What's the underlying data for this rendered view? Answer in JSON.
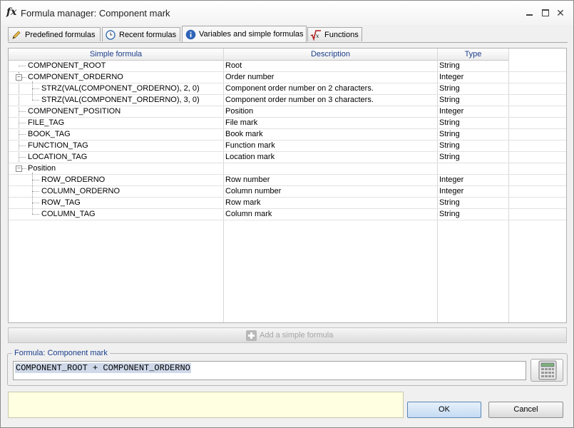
{
  "window": {
    "title": "Formula manager: Component mark",
    "icon": "fx-icon"
  },
  "tabs": [
    {
      "label": "Predefined formulas",
      "icon": "pencil-icon"
    },
    {
      "label": "Recent formulas",
      "icon": "clock-icon"
    },
    {
      "label": "Variables and simple formulas",
      "icon": "info-icon",
      "active": true
    },
    {
      "label": "Functions",
      "icon": "sqrt-x-icon"
    }
  ],
  "grid": {
    "headers": {
      "formula": "Simple formula",
      "description": "Description",
      "type": "Type"
    },
    "rows": [
      {
        "formula": "COMPONENT_ROOT",
        "description": "Root",
        "type": "String"
      },
      {
        "formula": "COMPONENT_ORDERNO",
        "description": "Order number",
        "type": "Integer"
      },
      {
        "formula": "STRZ(VAL(COMPONENT_ORDERNO), 2, 0)",
        "description": "Component order number on 2 characters.",
        "type": "String"
      },
      {
        "formula": "STRZ(VAL(COMPONENT_ORDERNO), 3, 0)",
        "description": "Component order number on 3 characters.",
        "type": "String"
      },
      {
        "formula": "COMPONENT_POSITION",
        "description": "Position",
        "type": "Integer"
      },
      {
        "formula": "FILE_TAG",
        "description": "File mark",
        "type": "String"
      },
      {
        "formula": "BOOK_TAG",
        "description": "Book mark",
        "type": "String"
      },
      {
        "formula": "FUNCTION_TAG",
        "description": "Function mark",
        "type": "String"
      },
      {
        "formula": "LOCATION_TAG",
        "description": "Location mark",
        "type": "String"
      },
      {
        "formula": "Position",
        "description": "",
        "type": ""
      },
      {
        "formula": "ROW_ORDERNO",
        "description": "Row number",
        "type": "Integer"
      },
      {
        "formula": "COLUMN_ORDERNO",
        "description": "Column number",
        "type": "Integer"
      },
      {
        "formula": "ROW_TAG",
        "description": "Row mark",
        "type": "String"
      },
      {
        "formula": "COLUMN_TAG",
        "description": "Column mark",
        "type": "String"
      }
    ]
  },
  "add_button": {
    "label": "Add a simple formula"
  },
  "formula": {
    "legend": "Formula: Component mark",
    "value": "COMPONENT_ROOT + COMPONENT_ORDERNO"
  },
  "buttons": {
    "ok": "OK",
    "cancel": "Cancel"
  },
  "colors": {
    "header_text": "#1a3d8a",
    "status_bg": "#ffffe1",
    "selection": "#cfd9ea"
  }
}
